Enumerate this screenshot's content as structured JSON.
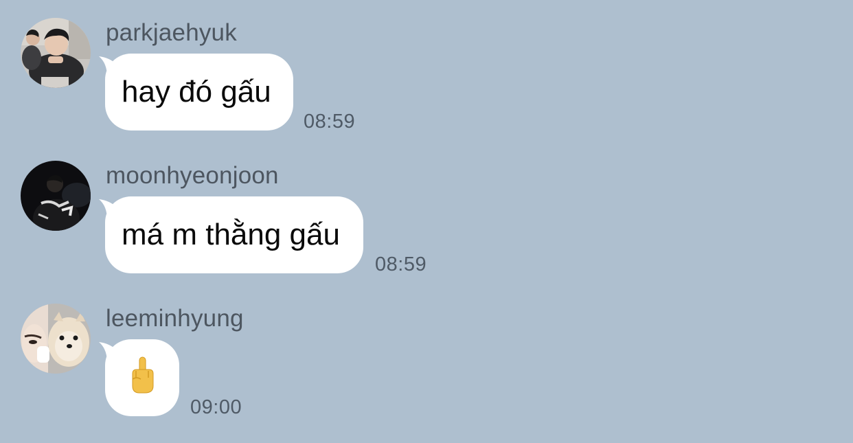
{
  "messages": [
    {
      "sender": "parkjaehyuk",
      "text": "hay đó gấu",
      "time": "08:59",
      "avatar_icon": "person-photo-avatar"
    },
    {
      "sender": "moonhyeonjoon",
      "text": "má m thằng gấu",
      "time": "08:59",
      "avatar_icon": "person-dark-photo-avatar"
    },
    {
      "sender": "leeminhyung",
      "text": "🖕",
      "time": "09:00",
      "avatar_icon": "dog-photo-avatar"
    }
  ],
  "colors": {
    "background": "#aebfcf",
    "bubble": "#ffffff",
    "sender_text": "#4d5660",
    "time_text": "#4f5a66"
  }
}
